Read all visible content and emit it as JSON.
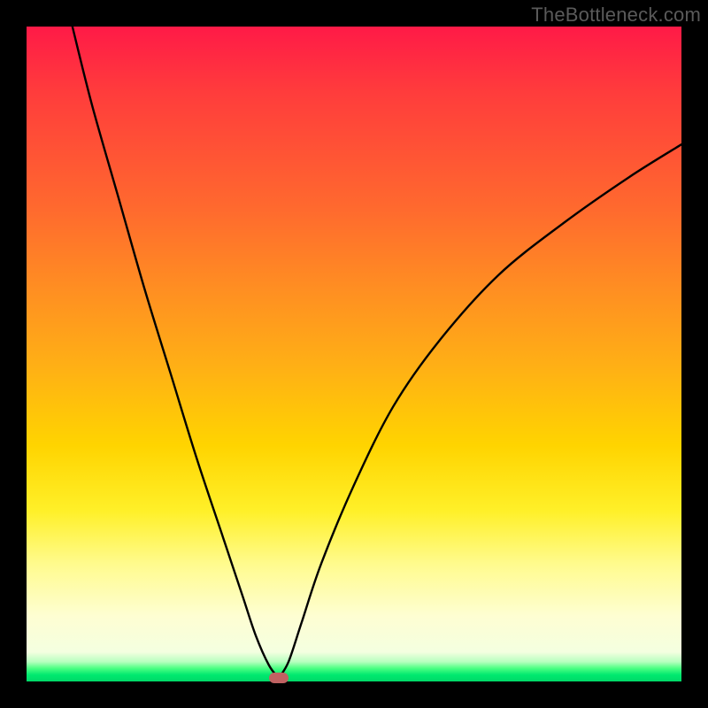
{
  "watermark": "TheBottleneck.com",
  "chart_data": {
    "type": "line",
    "title": "",
    "xlabel": "",
    "ylabel": "",
    "xlim": [
      0,
      100
    ],
    "ylim": [
      0,
      100
    ],
    "gradient_zones_top_to_bottom": [
      "red",
      "orange",
      "yellow",
      "pale-yellow",
      "green"
    ],
    "series": [
      {
        "name": "left-branch",
        "x": [
          7,
          10,
          14,
          18,
          22,
          26,
          30,
          33,
          35,
          37,
          38.5
        ],
        "y": [
          100,
          88,
          74,
          60,
          47,
          34,
          22,
          13,
          7,
          2.5,
          0.5
        ]
      },
      {
        "name": "right-branch",
        "x": [
          38.5,
          40,
          42,
          45,
          50,
          56,
          63,
          72,
          82,
          92,
          100
        ],
        "y": [
          0.5,
          3,
          9,
          18,
          30,
          42,
          52,
          62,
          70,
          77,
          82
        ]
      }
    ],
    "marker": {
      "name": "bottleneck-point",
      "x": 38.5,
      "y": 0.5
    },
    "colors": {
      "curve": "#000000",
      "marker": "#c06262",
      "frame": "#000000"
    }
  }
}
